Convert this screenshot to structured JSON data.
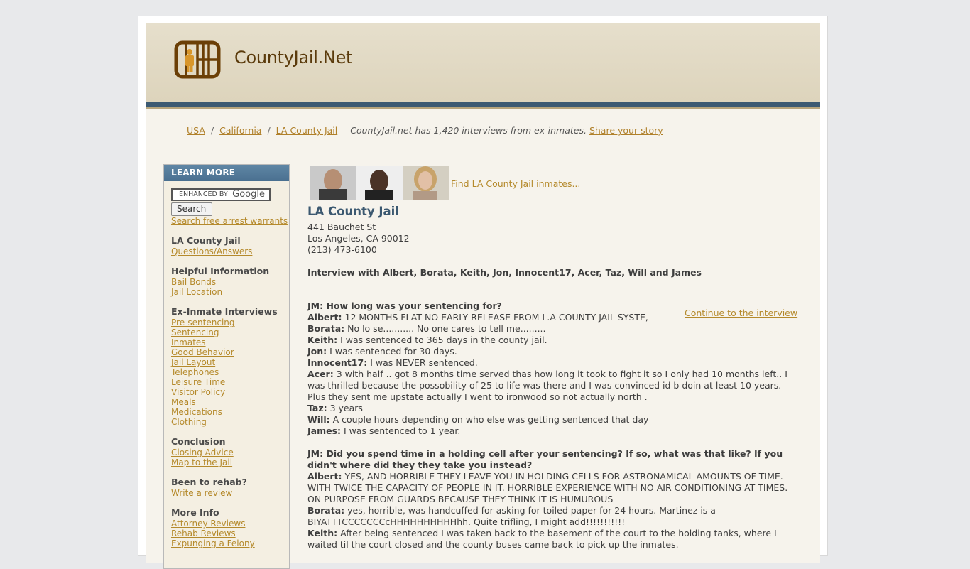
{
  "site": {
    "name": "CountyJail.Net"
  },
  "breadcrumb": {
    "items": [
      "USA",
      "California",
      "LA County Jail"
    ],
    "note": "CountyJail.net has 1,420 interviews from ex-inmates.",
    "share_link": "Share your story"
  },
  "sidebar": {
    "header": "LEARN MORE",
    "search_brand": "ENHANCED BY",
    "search_logo": "Google",
    "search_button": "Search",
    "arrest_link": "Search free arrest warrants",
    "groups": [
      {
        "title": "LA County Jail",
        "links": [
          "Questions/Answers"
        ]
      },
      {
        "title": "Helpful Information",
        "links": [
          "Bail Bonds",
          "Jail Location"
        ]
      },
      {
        "title": "Ex-Inmate Interviews",
        "links": [
          "Pre-sentencing",
          "Sentencing",
          "Inmates",
          "Good Behavior",
          "Jail Layout",
          "Telephones",
          "Leisure Time",
          "Visitor Policy",
          "Meals",
          "Medications",
          "Clothing"
        ]
      },
      {
        "title": "Conclusion",
        "links": [
          "Closing Advice",
          "Map to the Jail"
        ]
      },
      {
        "title": "Been to rehab?",
        "links": [
          "Write a review"
        ]
      },
      {
        "title": "More Info",
        "links": [
          "Attorney Reviews",
          "Rehab Reviews",
          "Expunging a Felony"
        ]
      }
    ]
  },
  "main": {
    "find_link": "Find LA County Jail inmates...",
    "title": "LA County Jail",
    "address": [
      "441 Bauchet St",
      "Los Angeles, CA 90012",
      "(213) 473-6100"
    ],
    "interview_heading": "Interview with Albert, Borata, Keith, Jon, Innocent17, Acer, Taz, Will and James",
    "continue_link": "Continue to the interview",
    "qa": [
      {
        "question": "JM: How long was your sentencing for?",
        "answers": [
          {
            "who": "Albert:",
            "text": "12 MONTHS FLAT NO EARLY RELEASE FROM L.A COUNTY JAIL SYSTE,"
          },
          {
            "who": "Borata:",
            "text": "No lo se........... No one cares to tell me........."
          },
          {
            "who": "Keith:",
            "text": "I was sentenced to 365 days in the county jail."
          },
          {
            "who": "Jon:",
            "text": "I was sentenced for 30 days."
          },
          {
            "who": "Innocent17:",
            "text": "I was NEVER sentenced."
          },
          {
            "who": "Acer:",
            "text": "3 with half .. got 8 months time served thas how long it took to fight it so I only had 10 months left.. I was thrilled because the possobility of 25 to life was there and I was convinced id b doin at least 10 years. Plus they sent me upstate actually I went to ironwood so not actually north ."
          },
          {
            "who": "Taz:",
            "text": "3 years"
          },
          {
            "who": "Will:",
            "text": "A couple hours depending on who else was getting sentenced that day"
          },
          {
            "who": "James:",
            "text": "I was sentenced to 1 year."
          }
        ]
      },
      {
        "question": "JM: Did you spend time in a holding cell after your sentencing? If so, what was that like? If you didn't where did they they take you instead?",
        "answers": [
          {
            "who": "Albert:",
            "text": "YES, AND HORRIBLE THEY LEAVE YOU IN HOLDING CELLS FOR ASTRONAMICAL AMOUNTS OF TIME. WITH TWICE THE CAPACITY OF PEOPLE IN IT. HORRIBLE EXPERIENCE WITH NO AIR CONDITIONING AT TIMES. ON PURPOSE FROM GUARDS BECAUSE THEY THINK IT IS HUMUROUS"
          },
          {
            "who": "Borata:",
            "text": "yes, horrible, was handcuffed for asking for toiled paper for 24 hours. Martinez is a BIYATTTCCCCCCCcHHHHHHHHHHhh. Quite trifling, I might add!!!!!!!!!!!"
          },
          {
            "who": "Keith:",
            "text": "After being sentenced I was taken back to the basement of the court to the holding tanks, where I waited til the court closed and the county buses came back to pick up the inmates."
          }
        ]
      }
    ]
  }
}
